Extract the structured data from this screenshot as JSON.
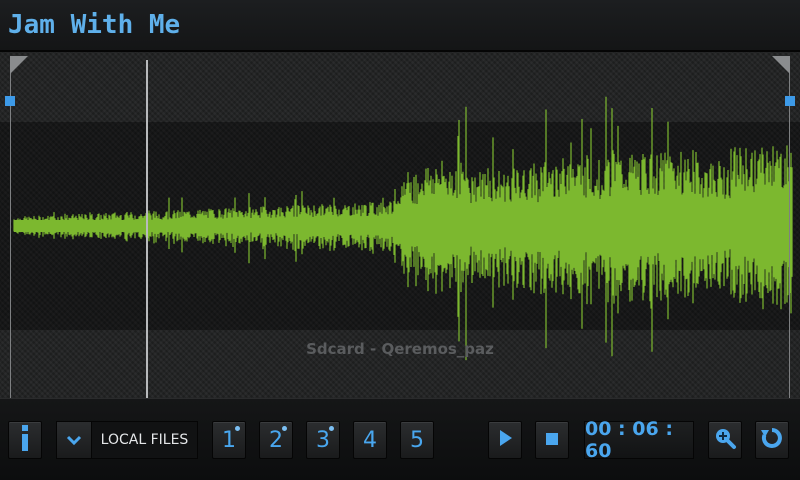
{
  "app": {
    "title": "Jam With Me"
  },
  "waveform": {
    "source_label": "Sdcard - Qeremos_paz",
    "wave_color": "#7cb82f",
    "playhead_color": "#b8babc",
    "handle_color": "#3d9ae8"
  },
  "toolbar": {
    "info_icon": "info-icon",
    "source_dropdown": {
      "icon": "chevron-down-icon",
      "label": "LOCAL FILES"
    },
    "slots": [
      {
        "label": "1",
        "has_content": true
      },
      {
        "label": "2",
        "has_content": true
      },
      {
        "label": "3",
        "has_content": true
      },
      {
        "label": "4",
        "has_content": false
      },
      {
        "label": "5",
        "has_content": false
      }
    ],
    "play_icon": "play-icon",
    "stop_icon": "stop-icon",
    "time": "00 : 06 : 60",
    "zoom_icon": "zoom-in-icon",
    "loop_icon": "loop-icon"
  },
  "colors": {
    "accent": "#4aa6ee",
    "title": "#5fb0ea",
    "background": "#0c0d0e"
  }
}
